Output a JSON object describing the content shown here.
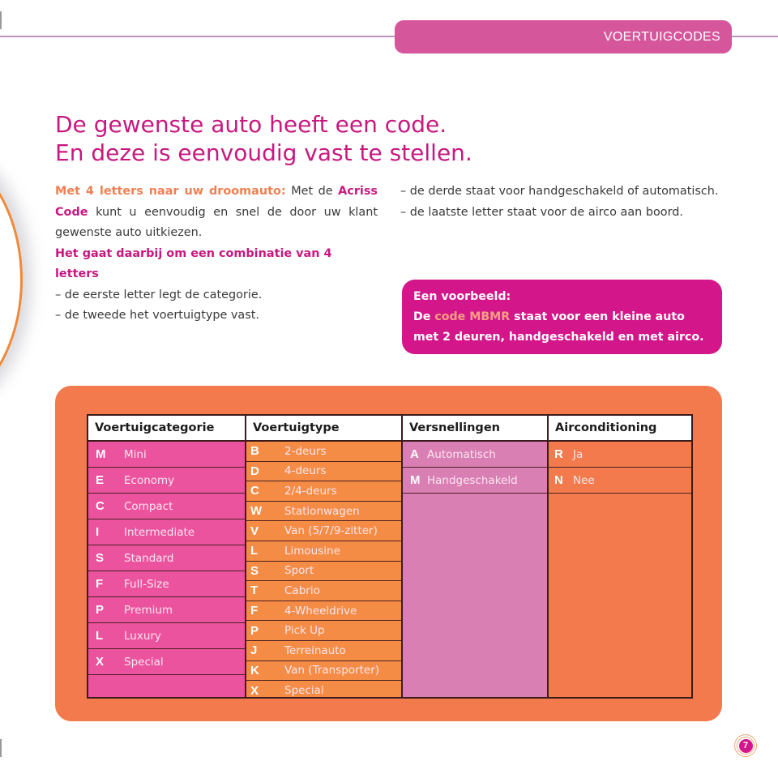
{
  "header": {
    "section_label": "VOERTUIGCODES"
  },
  "title": {
    "line1": "De gewenste auto heeft een code.",
    "line2": "En deze is eenvoudig vast te stellen."
  },
  "intro": {
    "lead_highlight": "Met 4 letters naar uw droomauto:",
    "lead_text_1": " Met de ",
    "acriss_code": "Acriss Code",
    "lead_text_2": " kunt u eenvoudig en snel de door uw klant gewenste auto uitkiezen.",
    "combination_text": "Het gaat daarbij om een combinatie van 4 letters",
    "points": [
      "– de eerste letter legt de categorie.",
      "– de tweede het voertuigtype vast.",
      "– de derde staat voor handgeschakeld of automatisch.",
      "– de laatste letter staat voor de airco aan boord."
    ]
  },
  "example": {
    "heading": "Een voorbeeld:",
    "text_before": "De ",
    "code_highlight": "code MBMR",
    "text_after": " staat voor een kleine auto met 2 deuren, handgeschakeld en met airco."
  },
  "colors": {
    "magenta": "#c7197f",
    "pink": "#d6569c",
    "orange": "#f27a4c",
    "category_bg": "#ec539f",
    "type_bg": "#f58c45",
    "transmission_bg": "#d97fb4"
  },
  "table": {
    "columns": [
      {
        "header": "Voertuigcategorie",
        "rows": [
          {
            "code": "M",
            "label": "Mini"
          },
          {
            "code": "E",
            "label": "Economy"
          },
          {
            "code": "C",
            "label": "Compact"
          },
          {
            "code": "I",
            "label": "Intermediate"
          },
          {
            "code": "S",
            "label": "Standard"
          },
          {
            "code": "F",
            "label": "Full-Size"
          },
          {
            "code": "P",
            "label": "Premium"
          },
          {
            "code": "L",
            "label": "Luxury"
          },
          {
            "code": "X",
            "label": "Special"
          }
        ]
      },
      {
        "header": "Voertuigtype",
        "rows": [
          {
            "code": "B",
            "label": "2-deurs"
          },
          {
            "code": "D",
            "label": "4-deurs"
          },
          {
            "code": "C",
            "label": "2/4-deurs"
          },
          {
            "code": "W",
            "label": "Stationwagen"
          },
          {
            "code": "V",
            "label": "Van (5/7/9-zitter)"
          },
          {
            "code": "L",
            "label": "Limousine"
          },
          {
            "code": "S",
            "label": "Sport"
          },
          {
            "code": "T",
            "label": "Cabrio"
          },
          {
            "code": "F",
            "label": "4-Wheeldrive"
          },
          {
            "code": "P",
            "label": "Pick Up"
          },
          {
            "code": "J",
            "label": "Terreinauto"
          },
          {
            "code": "K",
            "label": "Van (Transporter)"
          },
          {
            "code": "X",
            "label": "Special"
          }
        ]
      },
      {
        "header": "Versnellingen",
        "rows": [
          {
            "code": "A",
            "label": "Automatisch"
          },
          {
            "code": "M",
            "label": "Handgeschakeld"
          }
        ]
      },
      {
        "header": "Airconditioning",
        "rows": [
          {
            "code": "R",
            "label": "Ja"
          },
          {
            "code": "N",
            "label": "Nee"
          }
        ]
      }
    ]
  },
  "footer": {
    "page_number": "7"
  }
}
